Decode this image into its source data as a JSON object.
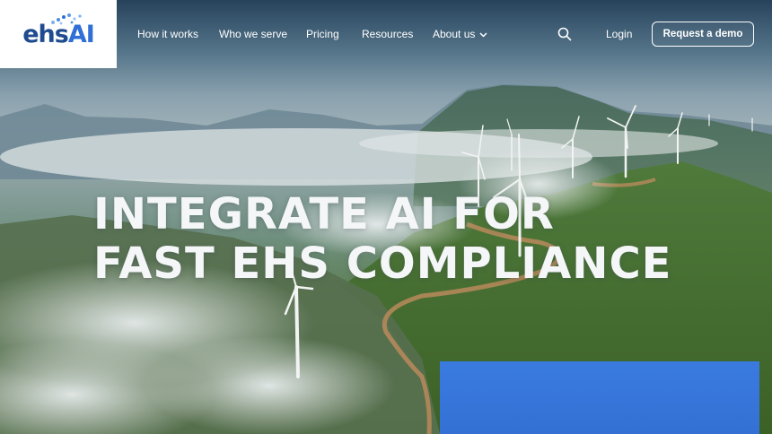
{
  "brand": {
    "logo_main": "ehs",
    "logo_accent": "AI"
  },
  "nav": {
    "items": [
      {
        "label": "How it works"
      },
      {
        "label": "Who we serve"
      },
      {
        "label": "Pricing"
      },
      {
        "label": "Resources"
      },
      {
        "label": "About us"
      }
    ],
    "login": "Login",
    "cta": "Request a demo"
  },
  "hero": {
    "line1": "INTEGRATE AI FOR",
    "line2": "FAST EHS COMPLIANCE"
  },
  "colors": {
    "brand_blue": "#2f6fd6",
    "card_blue": "#3a7be0"
  },
  "icons": [
    "search-icon",
    "chevron-down-icon"
  ]
}
